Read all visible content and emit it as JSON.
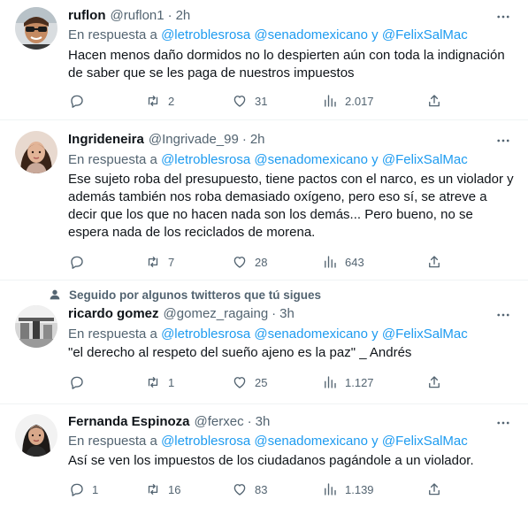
{
  "reply_prefix": "En respuesta a",
  "reply_and": "y",
  "reply_targets": [
    "@letroblesrosa",
    "@senadomexicano",
    "@FelixSalMac"
  ],
  "social_context": "Seguido por algunos twitteros que tú sigues",
  "icons": {
    "more": "more-horizontal-icon",
    "reply": "reply-bubble-icon",
    "retweet": "retweet-icon",
    "like": "heart-icon",
    "views": "bar-chart-icon",
    "share": "share-upload-icon",
    "social": "person-icon"
  },
  "colors": {
    "link": "#1d9bf0",
    "muted": "#536471",
    "text": "#0f1419",
    "divider": "#eff3f4"
  },
  "tweets": [
    {
      "name": "ruflon",
      "handle": "@ruflon1",
      "time": "2h",
      "text": "Hacen menos daño dormidos no lo despierten aún con toda la indignación de saber que se les paga de nuestros impuestos",
      "replies": "",
      "retweets": "2",
      "likes": "31",
      "views": "2.017"
    },
    {
      "name": "Ingrideneira",
      "handle": "@Ingrivade_99",
      "time": "2h",
      "text": "Ese sujeto roba del presupuesto, tiene pactos con el narco, es un violador y además también nos roba demasiado oxígeno, pero eso sí, se atreve a decir que los que no hacen nada son los demás... Pero bueno, no se espera nada de los reciclados de morena.",
      "replies": "",
      "retweets": "7",
      "likes": "28",
      "views": "643"
    },
    {
      "name": "ricardo gomez",
      "handle": "@gomez_ragaing",
      "time": "3h",
      "text": "\"el derecho al respeto del sueño ajeno es la paz\" _ Andrés",
      "replies": "",
      "retweets": "1",
      "likes": "25",
      "views": "1.127"
    },
    {
      "name": "Fernanda Espinoza",
      "handle": "@ferxec",
      "time": "3h",
      "text": "Así se ven los impuestos de los ciudadanos pagándole a un violador.",
      "replies": "1",
      "retweets": "16",
      "likes": "83",
      "views": "1.139"
    }
  ]
}
